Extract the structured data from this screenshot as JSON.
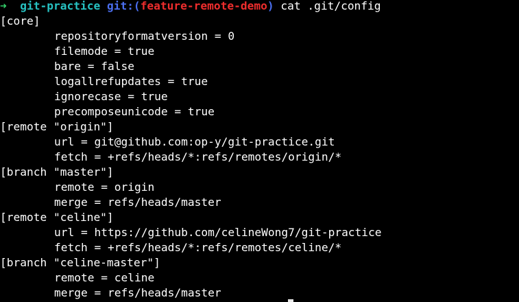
{
  "prompt": {
    "arrow": "➜",
    "directory": "git-practice",
    "git_label": "git:(",
    "branch": "feature-remote-demo",
    "git_close": ")",
    "command": "cat .git/config"
  },
  "output": {
    "core_header": "[core]",
    "core": [
      "repositoryformatversion = 0",
      "filemode = true",
      "bare = false",
      "logallrefupdates = true",
      "ignorecase = true",
      "precomposeunicode = true"
    ],
    "remote_origin_header": "[remote \"origin\"]",
    "remote_origin": [
      "url = git@github.com:op-y/git-practice.git",
      "fetch = +refs/heads/*:refs/remotes/origin/*"
    ],
    "branch_master_header": "[branch \"master\"]",
    "branch_master": [
      "remote = origin",
      "merge = refs/heads/master"
    ],
    "remote_celine_header": "[remote \"celine\"]",
    "remote_celine": [
      "url = https://github.com/celineWong7/git-practice",
      "fetch = +refs/heads/*:refs/remotes/celine/*"
    ],
    "branch_celine_master_header": "[branch \"celine-master\"]",
    "branch_celine_master": [
      "remote = celine",
      "merge = refs/heads/master"
    ]
  },
  "colors": {
    "background": "#000000",
    "text": "#ffffff",
    "arrow": "#34d36b",
    "directory": "#27c2c2",
    "git_label": "#4b6ff0",
    "branch": "#ee2d2d"
  }
}
